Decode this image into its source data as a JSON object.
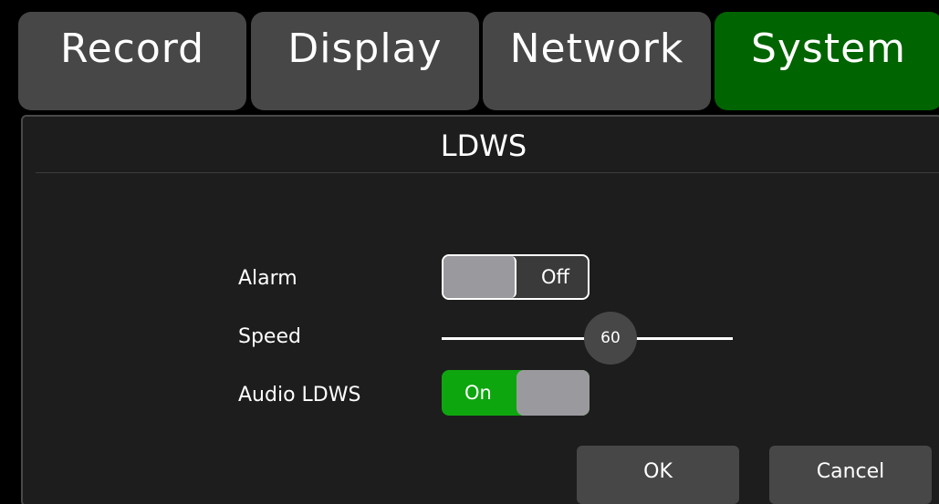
{
  "tabs": [
    {
      "label": "Record",
      "active": false
    },
    {
      "label": "Display",
      "active": false
    },
    {
      "label": "Network",
      "active": false
    },
    {
      "label": "System",
      "active": true
    }
  ],
  "dialog": {
    "title": "LDWS",
    "alarm": {
      "label": "Alarm",
      "state": "Off"
    },
    "speed": {
      "label": "Speed",
      "value": "60"
    },
    "audio_ldws": {
      "label": "Audio LDWS",
      "state": "On"
    }
  },
  "buttons": {
    "ok": "OK",
    "cancel": "Cancel"
  },
  "colors": {
    "active_tab": "#006400",
    "tab": "#474747",
    "toggle_on": "#0ea60e",
    "knob": "#9a9a9e",
    "panel": "#1d1d1d"
  }
}
